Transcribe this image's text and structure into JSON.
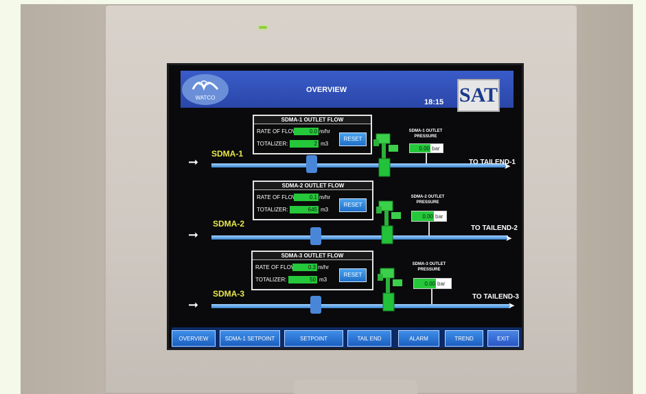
{
  "header": {
    "title": "OVERVIEW",
    "time": "18:15",
    "logo_text": "WATCO",
    "brand": "SAT"
  },
  "streams": [
    {
      "label": "SDMA-1",
      "panel_title": "SDMA-1 OUTLET FLOW",
      "rate_label": "RATE OF FLOW:",
      "rate_value": "0.0",
      "rate_unit": "m/hr",
      "total_label": "TOTALIZER:",
      "total_value": "2",
      "total_unit": "m3",
      "reset": "RESET",
      "pressure_title": "SDMA-1 OUTLET PRESSURE",
      "pressure_value": "0.00",
      "pressure_unit": "bar",
      "dest": "TO TAILEND-1"
    },
    {
      "label": "SDMA-2",
      "panel_title": "SDMA-2 OUTLET FLOW",
      "rate_label": "RATE OF FLOW:",
      "rate_value": "0.1",
      "rate_unit": "m/hr",
      "total_label": "TOTALIZER:",
      "total_value": "645",
      "total_unit": "m3",
      "reset": "RESET",
      "pressure_title": "SDMA-2 OUTLET PRESSURE",
      "pressure_value": "0.00",
      "pressure_unit": "bar",
      "dest": "TO TAILEND-2"
    },
    {
      "label": "SDMA-3",
      "panel_title": "SDMA-3 OUTLET FLOW",
      "rate_label": "RATE OF FLOW:",
      "rate_value": "0.3",
      "rate_unit": "m/hr",
      "total_label": "TOTALIZER:",
      "total_value": "50",
      "total_unit": "m3",
      "reset": "RESET",
      "pressure_title": "SDMA-3 OUTLET PRESSURE",
      "pressure_value": "0.00",
      "pressure_unit": "bar",
      "dest": "TO TAILEND-3"
    }
  ],
  "nav": [
    "OVERVIEW",
    "SDMA-1 SETPOINT",
    "SETPOINT",
    "TAIL END",
    "ALARM",
    "TREND",
    "EXIT"
  ],
  "colors": {
    "header": "#2a46a8",
    "value_green": "#25c83a",
    "label_yellow": "#e8e84a",
    "pipe": "#6aaef0"
  }
}
